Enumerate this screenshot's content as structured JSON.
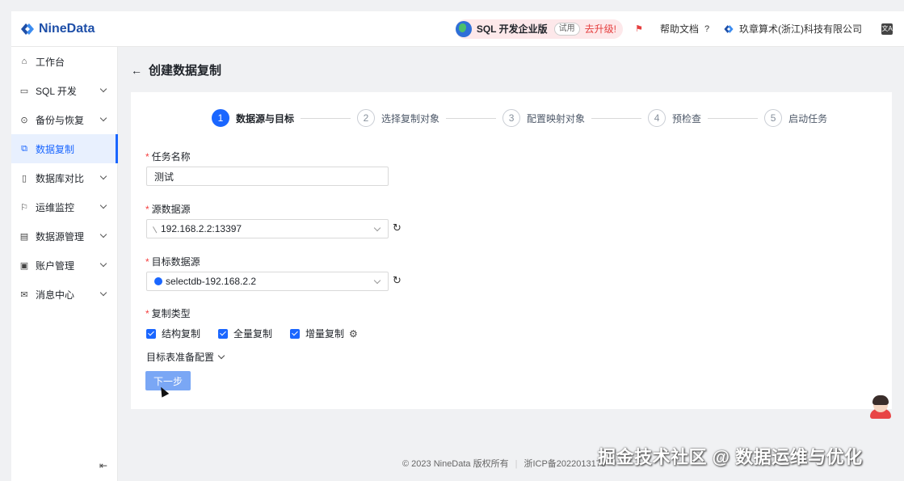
{
  "header": {
    "logo_text": "NineData",
    "sql_edition": "SQL 开发企业版",
    "trial_badge": "试用",
    "upgrade_link": "去升级!",
    "help_docs": "帮助文档",
    "org_name": "玖章算术(浙江)科技有限公司",
    "lang_label": "文A"
  },
  "sidebar": {
    "items": [
      {
        "label": "工作台",
        "icon": "home-icon",
        "glyph": "⌂",
        "chevron": false
      },
      {
        "label": "SQL 开发",
        "icon": "monitor-icon",
        "glyph": "▭",
        "chevron": true
      },
      {
        "label": "备份与恢复",
        "icon": "backup-icon",
        "glyph": "⊙",
        "chevron": true
      },
      {
        "label": "数据复制",
        "icon": "replication-icon",
        "glyph": "⧉",
        "chevron": false,
        "active": true
      },
      {
        "label": "数据库对比",
        "icon": "compare-icon",
        "glyph": "▯",
        "chevron": true
      },
      {
        "label": "运维监控",
        "icon": "monitor-alarm-icon",
        "glyph": "⚐",
        "chevron": true
      },
      {
        "label": "数据源管理",
        "icon": "datasource-icon",
        "glyph": "▤",
        "chevron": true
      },
      {
        "label": "账户管理",
        "icon": "account-icon",
        "glyph": "▣",
        "chevron": true
      },
      {
        "label": "消息中心",
        "icon": "mail-icon",
        "glyph": "✉",
        "chevron": true
      }
    ],
    "collapse_glyph": "⇤"
  },
  "page": {
    "title": "创建数据复制"
  },
  "steps": [
    {
      "num": "1",
      "label": "数据源与目标",
      "active": true
    },
    {
      "num": "2",
      "label": "选择复制对象"
    },
    {
      "num": "3",
      "label": "配置映射对象"
    },
    {
      "num": "4",
      "label": "预检查"
    },
    {
      "num": "5",
      "label": "启动任务"
    }
  ],
  "form": {
    "task_name_label": "任务名称",
    "task_name_value": "测试",
    "source_label": "源数据源",
    "source_value": "192.168.2.2:13397",
    "target_label": "目标数据源",
    "target_value": "selectdb-192.168.2.2",
    "type_label": "复制类型",
    "checks": [
      "结构复制",
      "全量复制",
      "增量复制"
    ],
    "advanced_label": "目标表准备配置",
    "next_label": "下一步"
  },
  "footer": {
    "copyright": "© 2023 NineData 版权所有",
    "icp": "浙ICP备2022013170"
  },
  "overlay_text": "掘金技术社区 @ 数据运维与优化"
}
